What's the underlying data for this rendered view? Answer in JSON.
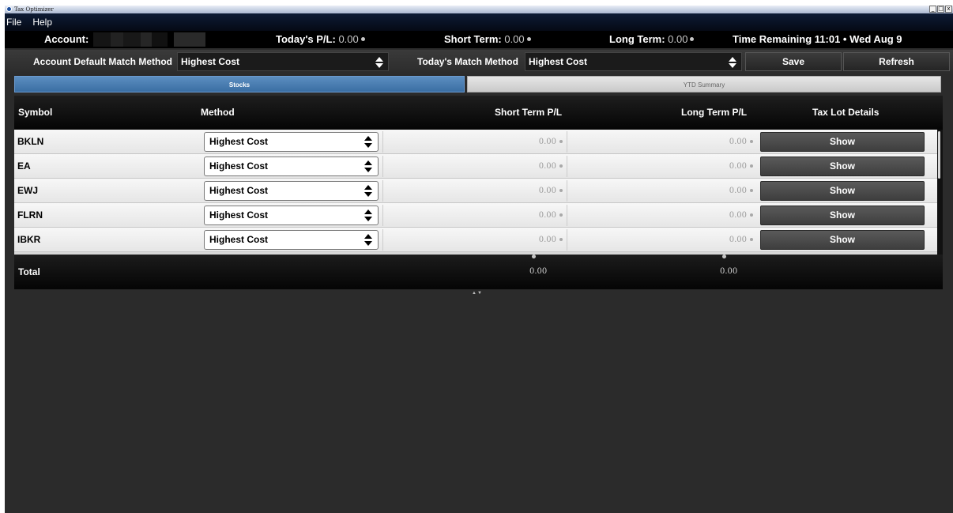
{
  "window": {
    "title": "Tax Optimizer",
    "buttons": [
      "_",
      "□",
      "x"
    ]
  },
  "menu": [
    "File",
    "Help"
  ],
  "account_bar": {
    "account_label": "Account:",
    "todays_pl_label": "Today's P/L:",
    "todays_pl_value": "0.00",
    "short_term_label": "Short Term:",
    "short_term_value": "0.00",
    "long_term_label": "Long Term:",
    "long_term_value": "0.00",
    "time_remaining": "Time Remaining 11:01 • Wed Aug 9"
  },
  "controls": {
    "default_method_label": "Account Default Match Method",
    "default_method_value": "Highest Cost",
    "today_method_label": "Today's Match Method",
    "today_method_value": "Highest Cost",
    "save_label": "Save",
    "refresh_label": "Refresh"
  },
  "tabs": [
    {
      "label": "Stocks",
      "active": true
    },
    {
      "label": "YTD Summary",
      "active": false
    }
  ],
  "table": {
    "columns": [
      "Symbol",
      "Method",
      "Short Term P/L",
      "Long Term P/L",
      "Tax Lot Details"
    ],
    "rows": [
      {
        "symbol": "BKLN",
        "method": "Highest Cost",
        "short_term": "0.00",
        "long_term": "0.00",
        "action": "Show"
      },
      {
        "symbol": "EA",
        "method": "Highest Cost",
        "short_term": "0.00",
        "long_term": "0.00",
        "action": "Show"
      },
      {
        "symbol": "EWJ",
        "method": "Highest Cost",
        "short_term": "0.00",
        "long_term": "0.00",
        "action": "Show"
      },
      {
        "symbol": "FLRN",
        "method": "Highest Cost",
        "short_term": "0.00",
        "long_term": "0.00",
        "action": "Show"
      },
      {
        "symbol": "IBKR",
        "method": "Highest Cost",
        "short_term": "0.00",
        "long_term": "0.00",
        "action": "Show"
      }
    ],
    "total": {
      "label": "Total",
      "short_term": "0.00",
      "long_term": "0.00"
    }
  },
  "splitter_glyph": "▲▼",
  "colors": {
    "tab_active": "#3a6ea3",
    "background": "#2b2b2b",
    "header": "#000000"
  }
}
